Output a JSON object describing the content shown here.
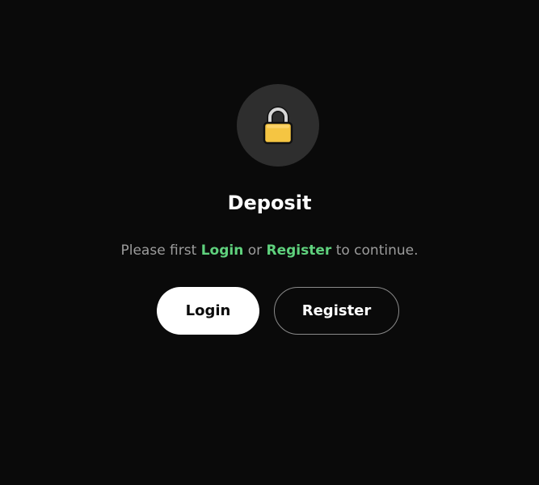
{
  "icon": "lock-icon",
  "title": "Deposit",
  "message": {
    "prefix": "Please first ",
    "login_link": "Login",
    "middle": " or ",
    "register_link": "Register",
    "suffix": " to continue."
  },
  "buttons": {
    "login_label": "Login",
    "register_label": "Register"
  },
  "colors": {
    "background": "#0a0a0a",
    "accent_green": "#5fd17d",
    "lock_yellow": "#f5c542"
  }
}
